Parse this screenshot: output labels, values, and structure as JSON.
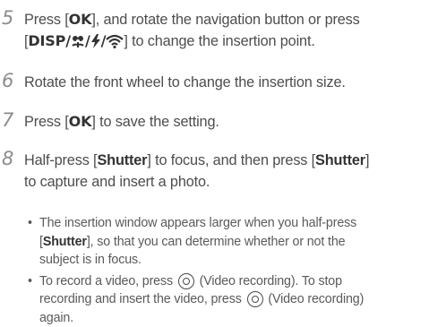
{
  "steps": [
    {
      "number": "5",
      "lines": [
        {
          "pre": "Press [",
          "key": "OK",
          "post": "], and rotate the navigation button or press"
        },
        {
          "pre": "[",
          "key": "DISP",
          "sep1": "/",
          "sep2": "/",
          "sep3": "/",
          "post": "] to change the insertion point."
        }
      ]
    },
    {
      "number": "6",
      "text": "Rotate the front wheel to change the insertion size."
    },
    {
      "number": "7",
      "pre": "Press [",
      "key": "OK",
      "post": "] to save the setting."
    },
    {
      "number": "8",
      "line1": {
        "a": "Half-press [",
        "b": "Shutter",
        "c": "] to focus, and then press [",
        "d": "Shutter",
        "e": "]"
      },
      "line2": "to capture and insert a photo."
    }
  ],
  "bullets": [
    {
      "bullet": "•",
      "l1": "The insertion window appears larger when you half-press",
      "l2a": "[",
      "l2b": "Shutter",
      "l2c": "], so that you can determine whether or not the",
      "l3": "subject is in focus."
    },
    {
      "bullet": "•",
      "l1a": "To record a video, press ",
      "l1b": " (Video recording). To stop",
      "l2a": "recording and insert the video, press ",
      "l2b": " (Video recording)",
      "l3": "again."
    }
  ],
  "icons": [
    "macro-flower-icon",
    "flash-bolt-icon",
    "wifi-icon",
    "video-record-icon"
  ],
  "colors": {
    "step_number": "#8c8c8c",
    "text": "#4d4d4d",
    "bold": "#333333"
  }
}
